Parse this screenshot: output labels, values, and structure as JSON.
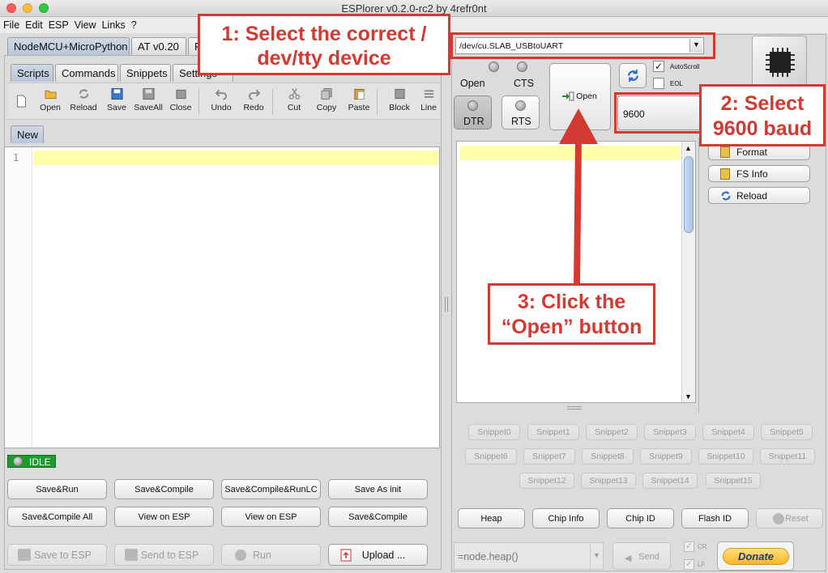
{
  "window": {
    "title": "ESPlorer v0.2.0-rc2 by 4refr0nt"
  },
  "menu": [
    "File",
    "Edit",
    "ESP",
    "View",
    "Links",
    "?"
  ],
  "fw_tabs": [
    "NodeMCU+MicroPython",
    "AT v0.20",
    "F"
  ],
  "sub_tabs": [
    "Scripts",
    "Commands",
    "Snippets",
    "Settings"
  ],
  "toolbar": [
    "Open",
    "Reload",
    "Save",
    "SaveAll",
    "Close",
    "Undo",
    "Redo",
    "Cut",
    "Copy",
    "Paste",
    "Block",
    "Line"
  ],
  "file_tab": "New",
  "editor": {
    "line_number": "1"
  },
  "status": {
    "label": "IDLE",
    "color": "#1e9b2f"
  },
  "script_buttons": {
    "row1": [
      "Save&Run",
      "Save&Compile",
      "Save&Compile&RunLC",
      "Save As init"
    ],
    "row2": [
      "Save&Compile All",
      "View on ESP",
      "View on ESP",
      "Save&Compile"
    ]
  },
  "bottom_left": {
    "save_to_esp": "Save to ESP",
    "send_to_esp": "Send to ESP",
    "run": "Run",
    "upload": "Upload ..."
  },
  "port": {
    "value": "/dev/cu.SLAB_USBtoUART"
  },
  "signals": {
    "open": "Open",
    "cts": "CTS",
    "dtr": "DTR",
    "rts": "RTS"
  },
  "open_button": "Open",
  "autoscroll": {
    "label": "AutoScroll",
    "checked": true
  },
  "eol": {
    "label": "EOL",
    "checked": false
  },
  "baud": {
    "value": "9600"
  },
  "fs_buttons": [
    "Format",
    "FS Info",
    "Reload"
  ],
  "snippets": {
    "row1": [
      "Snippet0",
      "Snippet1",
      "Snippet2",
      "Snippet3",
      "Snippet4",
      "Snippet5"
    ],
    "row2": [
      "Snippet6",
      "Snippet7",
      "Snippet8",
      "Snippet9",
      "Snippet10",
      "Snippet11"
    ],
    "row3": [
      "Snippet12",
      "Snippet13",
      "Snippet14",
      "Snippet15"
    ]
  },
  "chip_buttons": [
    "Heap",
    "Chip Info",
    "Chip ID",
    "Flash ID",
    "Reset"
  ],
  "command": {
    "value": "=node.heap()",
    "send": "Send",
    "cr": "CR",
    "lf": "LF"
  },
  "donate": "Donate",
  "annotations": {
    "step1": [
      "1: Select the correct /",
      "dev/tty device"
    ],
    "step2": [
      "2: Select",
      "9600 baud"
    ],
    "step3": [
      "3: Click the",
      "“Open” button"
    ],
    "color": "#d23a32"
  }
}
